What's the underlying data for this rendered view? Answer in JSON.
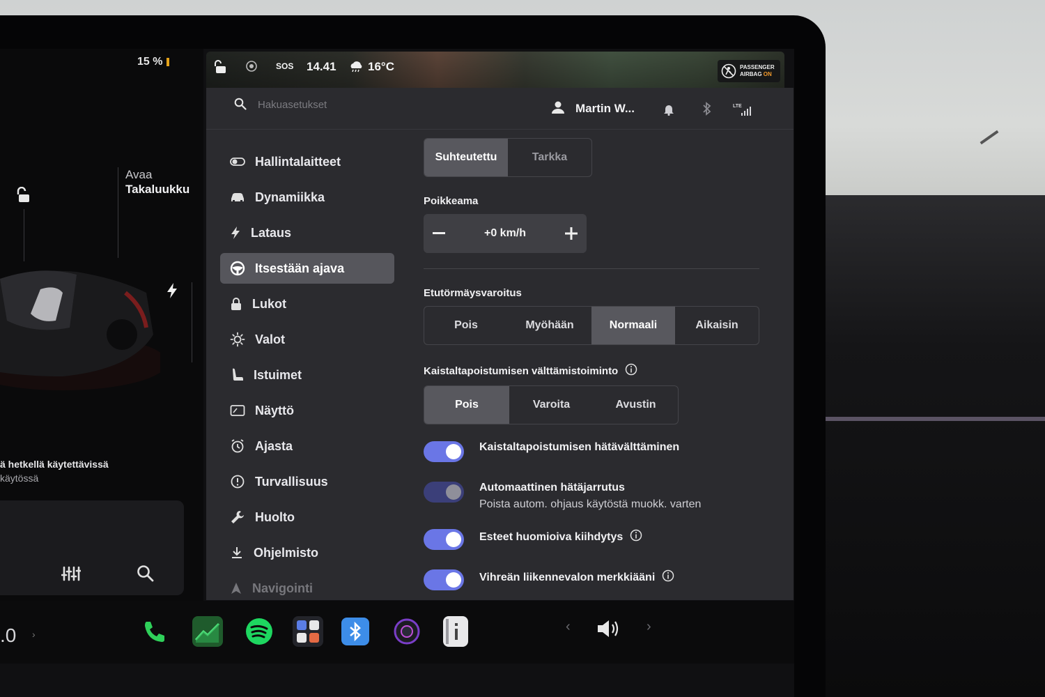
{
  "status_bar": {
    "battery_percent": "15 %",
    "sos": "SOS",
    "time": "14.41",
    "temperature": "16°C",
    "airbag_line1": "PASSENGER",
    "airbag_line2": "AIRBAG",
    "airbag_state": "ON"
  },
  "car_panel": {
    "trunk_line1": "Avaa",
    "trunk_line2": "Takaluukku",
    "status_line1": "ä hetkellä käytettävissä",
    "status_line2": "käytössä",
    "speed_partial": ".0"
  },
  "header": {
    "search_placeholder": "Hakuasetukset",
    "user_name": "Martin W...",
    "network": "LTE"
  },
  "sidebar": {
    "items": [
      {
        "label": "Hallintalaitteet",
        "icon": "toggle-icon"
      },
      {
        "label": "Dynamiikka",
        "icon": "car-icon"
      },
      {
        "label": "Lataus",
        "icon": "bolt-icon"
      },
      {
        "label": "Itsestään ajava",
        "icon": "steering-wheel-icon",
        "active": true
      },
      {
        "label": "Lukot",
        "icon": "lock-icon"
      },
      {
        "label": "Valot",
        "icon": "sun-icon"
      },
      {
        "label": "Istuimet",
        "icon": "seat-icon"
      },
      {
        "label": "Näyttö",
        "icon": "display-icon"
      },
      {
        "label": "Ajasta",
        "icon": "alarm-clock-icon"
      },
      {
        "label": "Turvallisuus",
        "icon": "alert-circle-icon"
      },
      {
        "label": "Huolto",
        "icon": "wrench-icon"
      },
      {
        "label": "Ohjelmisto",
        "icon": "download-icon"
      },
      {
        "label": "Navigointi",
        "icon": "navigation-icon"
      }
    ]
  },
  "content": {
    "offset_mode": {
      "options": [
        "Suhteutettu",
        "Tarkka"
      ],
      "selected": "Suhteutettu"
    },
    "offset_label": "Poikkeama",
    "offset_value": "+0 km/h",
    "fcw_label": "Etutörmäysvaroitus",
    "fcw": {
      "options": [
        "Pois",
        "Myöhään",
        "Normaali",
        "Aikaisin"
      ],
      "selected": "Normaali"
    },
    "lda_label": "Kaistaltapoistumisen välttämistoiminto",
    "lda": {
      "options": [
        "Pois",
        "Varoita",
        "Avustin"
      ],
      "selected": "Pois"
    },
    "toggles": [
      {
        "label": "Kaistaltapoistumisen hätäväl­ttäminen",
        "on": true
      },
      {
        "label": "Automaattinen hätäjarrutus",
        "sublabel": "Poista autom. ohjaus käytöstä muokk. varten",
        "on": true,
        "disabled": true
      },
      {
        "label": "Esteet huomioiva kiihdytys",
        "on": true,
        "info": true
      },
      {
        "label": "Vihreän liikennevalon merkkiääni",
        "on": true,
        "info": true
      }
    ]
  },
  "dock": {
    "apps": [
      "phone-icon",
      "energy-icon",
      "spotify-icon",
      "app-launcher-icon",
      "bluetooth-icon",
      "camera-icon",
      "manual-icon"
    ],
    "volume_icon": "volume-icon"
  },
  "colors": {
    "toggle_on": "#6a76e6",
    "panel_bg": "#2b2b2f",
    "selected_option": "#58585e",
    "battery_bar": "#e3a21a"
  }
}
